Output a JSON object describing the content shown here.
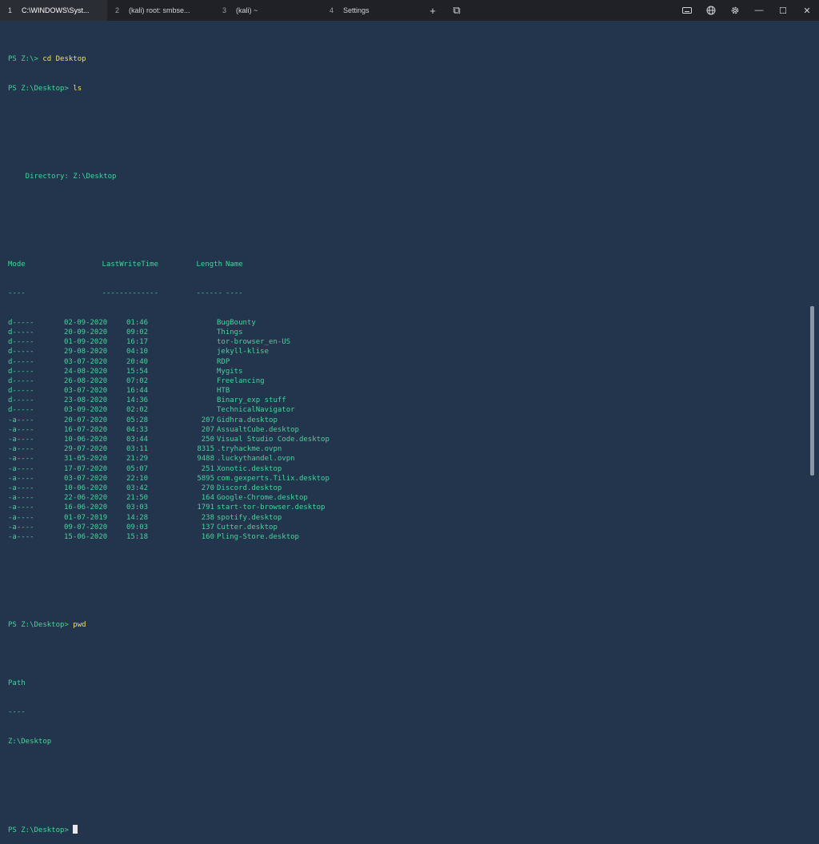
{
  "tabs": [
    {
      "num": "1",
      "label": "C:\\WINDOWS\\Syst...",
      "active": true
    },
    {
      "num": "2",
      "label": "(kali) root: smbse...",
      "active": false
    },
    {
      "num": "3",
      "label": "(kali) ~",
      "active": false
    },
    {
      "num": "4",
      "label": "Settings",
      "active": false
    }
  ],
  "controls": {
    "new_tab": "+",
    "tab_switcher": "⧉",
    "minimize": "—",
    "maximize": "☐",
    "close": "✕"
  },
  "console": {
    "prompt1": "PS Z:\\> ",
    "cmd1": "cd Desktop",
    "prompt2": "PS Z:\\Desktop> ",
    "cmd2": "ls",
    "directory_line": "    Directory: Z:\\Desktop",
    "headers": {
      "mode": "Mode",
      "lastwrite": "LastWriteTime",
      "length": "Length",
      "name": "Name"
    },
    "underlines": {
      "mode": "----",
      "lastwrite": "-------------",
      "length": "------",
      "name": "----"
    },
    "entries": [
      {
        "mode": "d-----",
        "date": "02-09-2020",
        "time": "01:46",
        "length": "",
        "name": "BugBounty"
      },
      {
        "mode": "d-----",
        "date": "20-09-2020",
        "time": "09:02",
        "length": "",
        "name": "Things"
      },
      {
        "mode": "d-----",
        "date": "01-09-2020",
        "time": "16:17",
        "length": "",
        "name": "tor-browser_en-US"
      },
      {
        "mode": "d-----",
        "date": "29-08-2020",
        "time": "04:10",
        "length": "",
        "name": "jekyll-klise"
      },
      {
        "mode": "d-----",
        "date": "03-07-2020",
        "time": "20:40",
        "length": "",
        "name": "RDP"
      },
      {
        "mode": "d-----",
        "date": "24-08-2020",
        "time": "15:54",
        "length": "",
        "name": "Mygits"
      },
      {
        "mode": "d-----",
        "date": "26-08-2020",
        "time": "07:02",
        "length": "",
        "name": "Freelancing"
      },
      {
        "mode": "d-----",
        "date": "03-07-2020",
        "time": "16:44",
        "length": "",
        "name": "HTB"
      },
      {
        "mode": "d-----",
        "date": "23-08-2020",
        "time": "14:36",
        "length": "",
        "name": "Binary_exp stuff"
      },
      {
        "mode": "d-----",
        "date": "03-09-2020",
        "time": "02:02",
        "length": "",
        "name": "TechnicalNavigator"
      },
      {
        "mode": "-a----",
        "date": "20-07-2020",
        "time": "05:28",
        "length": "207",
        "name": "Gidhra.desktop"
      },
      {
        "mode": "-a----",
        "date": "16-07-2020",
        "time": "04:33",
        "length": "207",
        "name": "AssualtCube.desktop"
      },
      {
        "mode": "-a----",
        "date": "10-06-2020",
        "time": "03:44",
        "length": "250",
        "name": "Visual Studio Code.desktop"
      },
      {
        "mode": "-a----",
        "date": "29-07-2020",
        "time": "03:11",
        "length": "8315",
        "name": ".tryhackme.ovpn"
      },
      {
        "mode": "-a----",
        "date": "31-05-2020",
        "time": "21:29",
        "length": "9488",
        "name": ".luckythandel.ovpn"
      },
      {
        "mode": "-a----",
        "date": "17-07-2020",
        "time": "05:07",
        "length": "251",
        "name": "Xonotic.desktop"
      },
      {
        "mode": "-a----",
        "date": "03-07-2020",
        "time": "22:10",
        "length": "5895",
        "name": "com.gexperts.Tilix.desktop"
      },
      {
        "mode": "-a----",
        "date": "10-06-2020",
        "time": "03:42",
        "length": "270",
        "name": "Discord.desktop"
      },
      {
        "mode": "-a----",
        "date": "22-06-2020",
        "time": "21:50",
        "length": "164",
        "name": "Google-Chrome.desktop"
      },
      {
        "mode": "-a----",
        "date": "16-06-2020",
        "time": "03:03",
        "length": "1791",
        "name": "start-tor-browser.desktop"
      },
      {
        "mode": "-a----",
        "date": "01-07-2019",
        "time": "14:28",
        "length": "238",
        "name": "spotify.desktop"
      },
      {
        "mode": "-a----",
        "date": "09-07-2020",
        "time": "09:03",
        "length": "137",
        "name": "Cutter.desktop"
      },
      {
        "mode": "-a----",
        "date": "15-06-2020",
        "time": "15:18",
        "length": "160",
        "name": "Pling-Store.desktop"
      }
    ],
    "prompt3": "PS Z:\\Desktop> ",
    "cmd3": "pwd",
    "path_header": "Path",
    "path_underline": "----",
    "path_value": "Z:\\Desktop",
    "prompt4": "PS Z:\\Desktop> "
  },
  "colors": {
    "background": "#22354c",
    "text": "#47d39c",
    "command": "#f1e05a",
    "titlebar": "#1f2126"
  }
}
